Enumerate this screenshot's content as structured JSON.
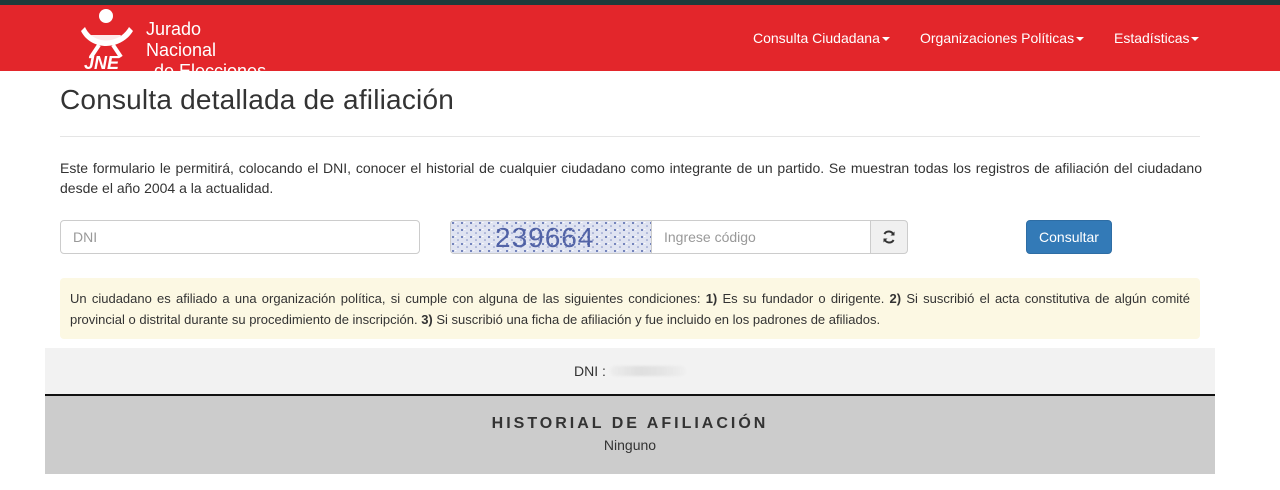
{
  "header": {
    "logo_text": "JNE",
    "brand_line1": "Jurado Nacional",
    "brand_line2": "de Elecciones",
    "menu": [
      {
        "label": "Consulta Ciudadana"
      },
      {
        "label": "Organizaciones Políticas"
      },
      {
        "label": "Estadísticas"
      }
    ],
    "accent": "#e3262b"
  },
  "main": {
    "title": "Consulta detallada de afiliación",
    "intro": "Este formulario le permitirá, colocando el DNI, conocer el historial de cualquier ciudadano como integrante de un partido. Se muestran todas los registros de afiliación del ciudadano desde el año 2004 a la actualidad.",
    "form": {
      "dni_placeholder": "DNI",
      "dni_value": "",
      "captcha_text": "239664",
      "code_placeholder": "Ingrese código",
      "code_value": "",
      "refresh_icon": "refresh-icon",
      "submit_label": "Consultar"
    },
    "alert": {
      "lead": "Un ciudadano es afiliado a una organización política, si cumple con alguna de las siguientes condiciones: ",
      "n1": "1)",
      "t1": " Es su fundador o dirigente. ",
      "n2": "2)",
      "t2": " Si suscribió el acta constitutiva de algún comité provincial o distrital durante su procedimiento de inscripción. ",
      "n3": "3)",
      "t3": " Si suscribió una ficha de afiliación y fue incluido en los padrones de afiliados."
    },
    "result": {
      "dni_label": "DNI :",
      "history_title": "HISTORIAL DE AFILIACIÓN",
      "history_value": "Ninguno"
    }
  }
}
